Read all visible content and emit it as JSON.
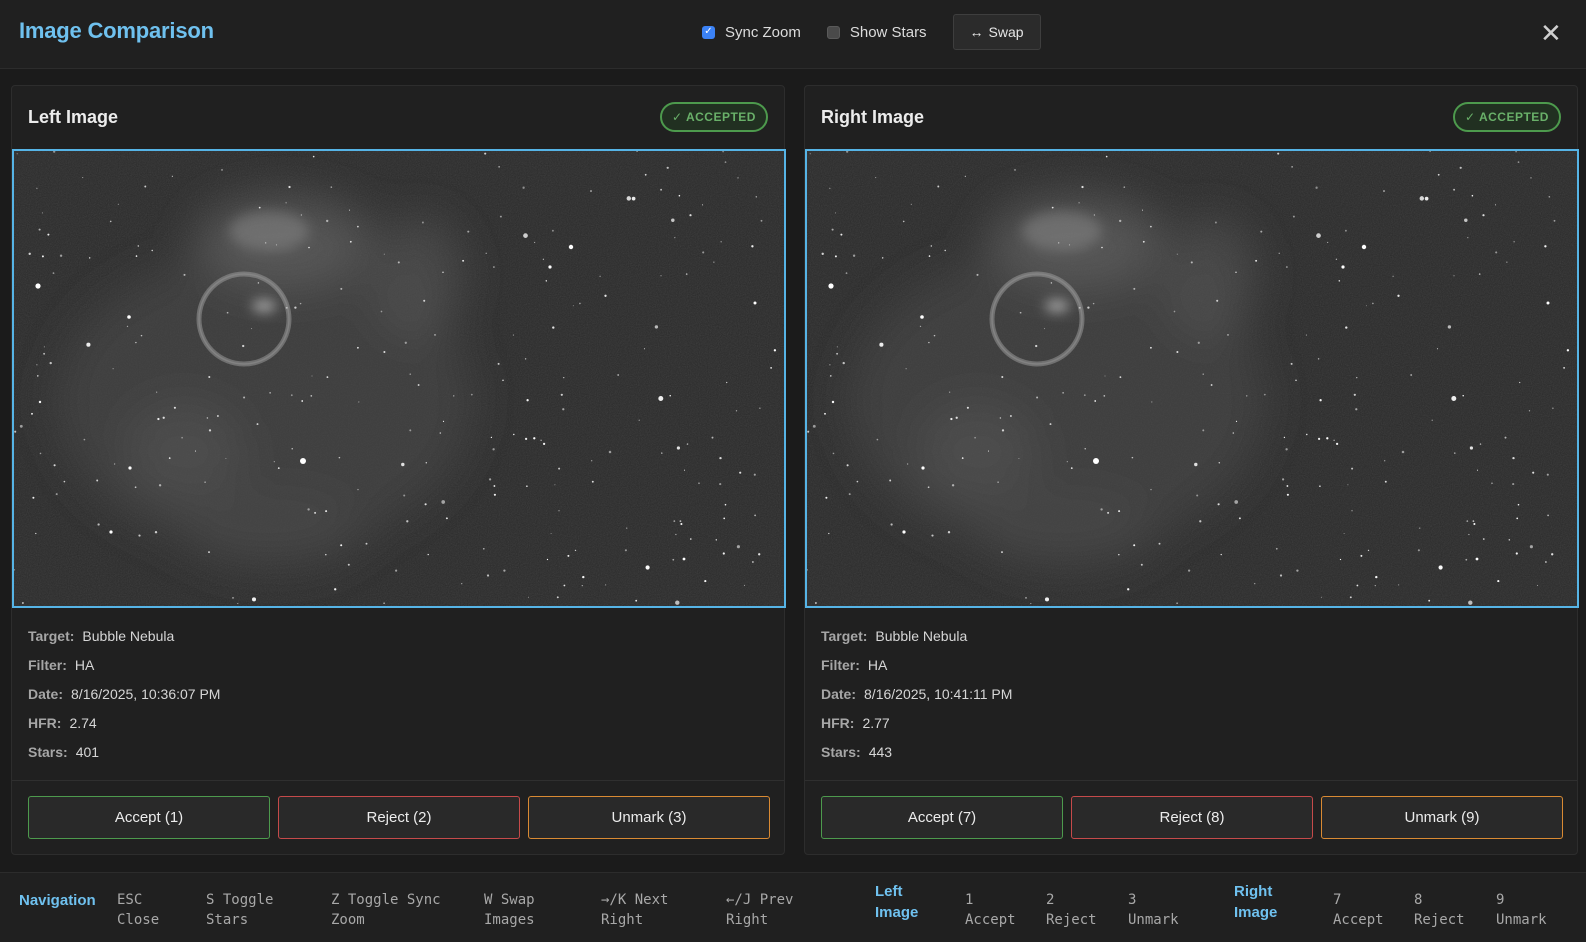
{
  "header": {
    "title": "Image Comparison",
    "sync_zoom": {
      "label": "Sync Zoom",
      "checked": true
    },
    "show_stars": {
      "label": "Show Stars",
      "checked": false
    },
    "swap_label": "Swap",
    "swap_icon": "↔",
    "close_icon": "✕"
  },
  "left": {
    "title": "Left Image",
    "status": "✓ ACCEPTED",
    "meta": [
      {
        "key": "Target:",
        "value": "Bubble Nebula"
      },
      {
        "key": "Filter:",
        "value": "HA"
      },
      {
        "key": "Date:",
        "value": "8/16/2025, 10:36:07 PM"
      },
      {
        "key": "HFR:",
        "value": "2.74"
      },
      {
        "key": "Stars:",
        "value": "401"
      }
    ],
    "buttons": {
      "accept": "Accept (1)",
      "reject": "Reject (2)",
      "unmark": "Unmark (3)"
    }
  },
  "right": {
    "title": "Right Image",
    "status": "✓ ACCEPTED",
    "meta": [
      {
        "key": "Target:",
        "value": "Bubble Nebula"
      },
      {
        "key": "Filter:",
        "value": "HA"
      },
      {
        "key": "Date:",
        "value": "8/16/2025, 10:41:11 PM"
      },
      {
        "key": "HFR:",
        "value": "2.77"
      },
      {
        "key": "Stars:",
        "value": "443"
      }
    ],
    "buttons": {
      "accept": "Accept (7)",
      "reject": "Reject (8)",
      "unmark": "Unmark (9)"
    }
  },
  "footer": {
    "navigation_label": "Navigation",
    "shortcuts": [
      {
        "line1": "ESC",
        "line2": "Close"
      },
      {
        "line1": "S Toggle",
        "line2": "Stars"
      },
      {
        "line1": "Z Toggle Sync",
        "line2": "Zoom"
      },
      {
        "line1": "W Swap",
        "line2": "Images"
      },
      {
        "line1": "→/K Next",
        "line2": "Right"
      },
      {
        "line1": "←/J Prev",
        "line2": "Right"
      }
    ],
    "left_image_label": {
      "line1": "Left",
      "line2": "Image"
    },
    "left_keys": [
      {
        "line1": "1",
        "line2": "Accept"
      },
      {
        "line1": "2",
        "line2": "Reject"
      },
      {
        "line1": "3",
        "line2": "Unmark"
      }
    ],
    "right_image_label": {
      "line1": "Right",
      "line2": "Image"
    },
    "right_keys": [
      {
        "line1": "7",
        "line2": "Accept"
      },
      {
        "line1": "8",
        "line2": "Reject"
      },
      {
        "line1": "9",
        "line2": "Unmark"
      }
    ]
  },
  "colors": {
    "accent": "#6fc1ef",
    "accept": "#4d9a4d",
    "reject": "#c54a4a",
    "unmark": "#d98a33",
    "image_border": "#56b4e6"
  }
}
